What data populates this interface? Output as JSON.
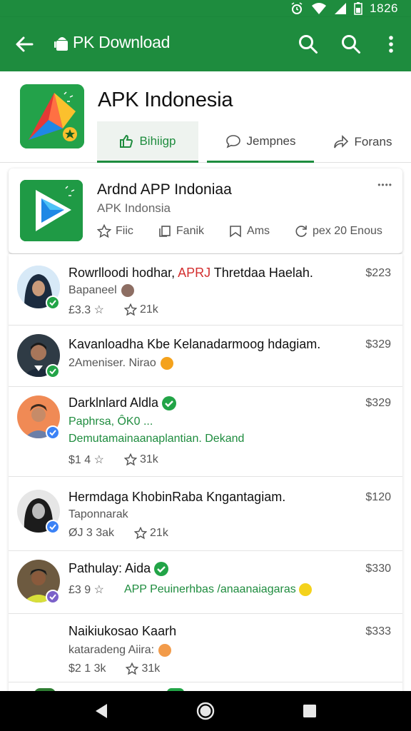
{
  "status": {
    "time": "1826"
  },
  "appbar": {
    "title": "PK Download"
  },
  "header": {
    "app_name": "APK Indonesia",
    "tabs": [
      {
        "label": "Bihiigp"
      },
      {
        "label": "Jempnes"
      },
      {
        "label": "Forans"
      }
    ]
  },
  "featured": {
    "title": "Ardnd APP Indoniaa",
    "subtitle": "APK Indonsia",
    "dots": "••••",
    "actions": [
      {
        "label": "Fiic"
      },
      {
        "label": "Fanik"
      },
      {
        "label": "Ams"
      },
      {
        "label": "pex 20 Enous"
      }
    ]
  },
  "rows": [
    {
      "title_pre": "Rowrlloodi hodhar, ",
      "title_hl": "APRJ",
      "title_post": " Thretdaa Haelah.",
      "subtitle": "Bapaneel",
      "meta_left": "£3.3 ☆",
      "meta_right": "21k",
      "price": "$223"
    },
    {
      "title": "Kavanloadha Kbe Kelanadarmoog hdagiam.",
      "subtitle": "2Ameniser. Nirao",
      "price": "$329"
    },
    {
      "title": "Darklnlard Aldla",
      "subtitle_green": "Paphrsa, ÔK0 ...",
      "subtitle2": "Demutamainaanaplantian. Dekand",
      "meta_left": "$1 4 ☆",
      "meta_right": "31k",
      "price": "$329"
    },
    {
      "title": "Hermdaga KhobinRaba Kngantagiam.",
      "subtitle": "Taponnarak",
      "meta_left": "ØJ 3 3ak",
      "meta_right": "21k",
      "price": "$120"
    },
    {
      "title": "Pathulay: Aida",
      "meta_left": "£3 9 ☆",
      "meta_green": "APP Peuinerhbas /anaanaiagaras",
      "price": "$330"
    },
    {
      "title": "Naikiukosao Kaarh",
      "subtitle": "kataradeng Aiira:",
      "meta_left": "$2 1 3k",
      "meta_right": "31k",
      "price": "$333"
    }
  ],
  "colors": {
    "primary": "#1e8c3e",
    "accent_red": "#d32f2f",
    "verified": "#22a447",
    "badge_blue": "#3b82f6"
  }
}
